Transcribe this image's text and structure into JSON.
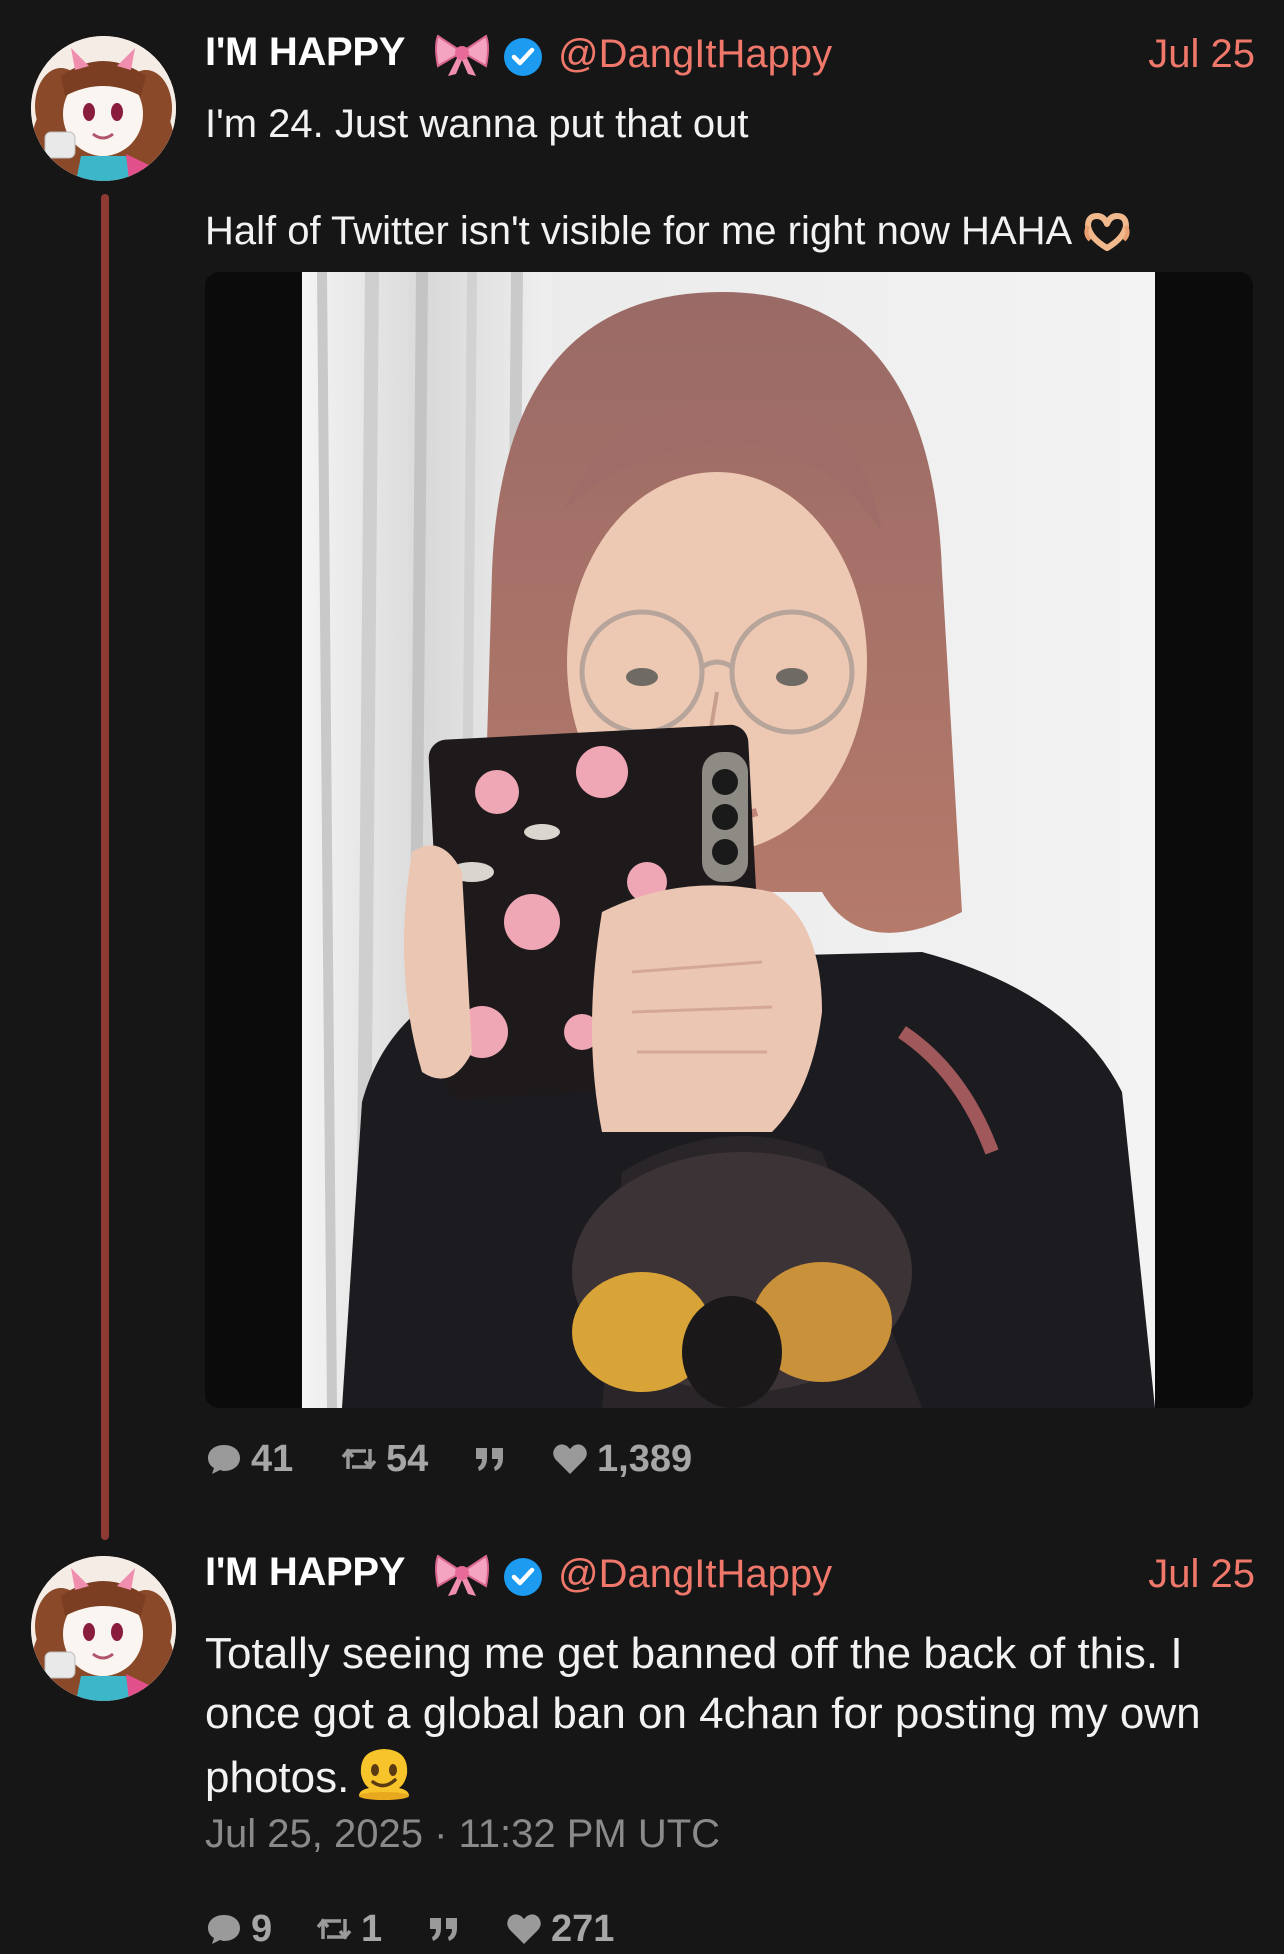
{
  "tweets": [
    {
      "author": {
        "display_name": "I'M HAPPY",
        "handle": "@DangItHappy",
        "verified_icon": "verified-badge-icon",
        "name_emoji_icon": "pink-bow-icon"
      },
      "date": "Jul 25",
      "text_line1": "I'm 24. Just wanna put that out",
      "text_line2": "Half of Twitter isn't visible for me right now HAHA",
      "text_emoji_icon": "heart-hands-icon",
      "media": {
        "type": "photo",
        "description_icon": "mirror-selfie-photo"
      },
      "stats": {
        "replies": "41",
        "retweets": "54",
        "quotes": "",
        "likes": "1,389"
      }
    },
    {
      "author": {
        "display_name": "I'M HAPPY",
        "handle": "@DangItHappy",
        "verified_icon": "verified-badge-icon",
        "name_emoji_icon": "pink-bow-icon"
      },
      "date": "Jul 25",
      "text": "Totally seeing me get banned off the back of this. I once got a global ban on 4chan for posting my own photos.",
      "text_emoji_icon": "melting-face-icon",
      "timestamp": "Jul 25, 2025 · 11:32 PM UTC",
      "stats": {
        "replies": "9",
        "retweets": "1",
        "quotes": "",
        "likes": "271"
      }
    }
  ],
  "colors": {
    "background": "#161617",
    "accent": "#f0786b",
    "thread_line": "#8c3a33",
    "verified": "#1d9bf0",
    "muted": "#9a9a9a"
  }
}
